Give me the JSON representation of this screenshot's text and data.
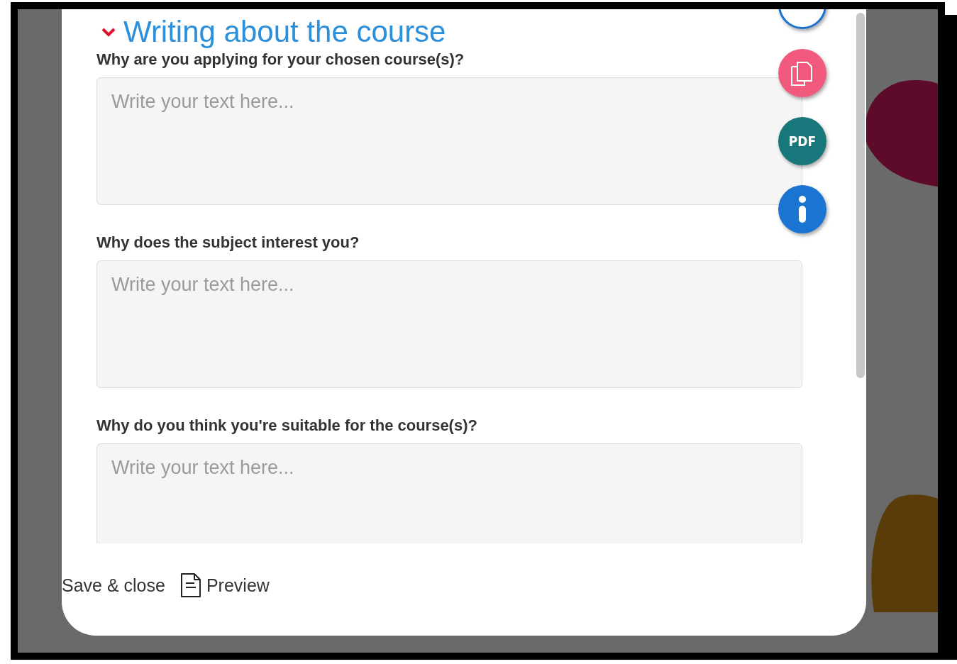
{
  "section": {
    "title": "Writing about the course",
    "expanded": true
  },
  "questions": [
    {
      "label": "Why are you applying for your chosen course(s)?",
      "placeholder": "Write your text here..."
    },
    {
      "label": "Why does the subject interest you?",
      "placeholder": "Write your text here..."
    },
    {
      "label": "Why do you think you're suitable for the course(s)?",
      "placeholder": "Write your text here..."
    }
  ],
  "side_actions": [
    {
      "kind": "outline"
    },
    {
      "kind": "copy"
    },
    {
      "kind": "pdf",
      "label": "PDF"
    },
    {
      "kind": "info"
    }
  ],
  "footer": {
    "save": "Save & close",
    "preview": "Preview"
  }
}
